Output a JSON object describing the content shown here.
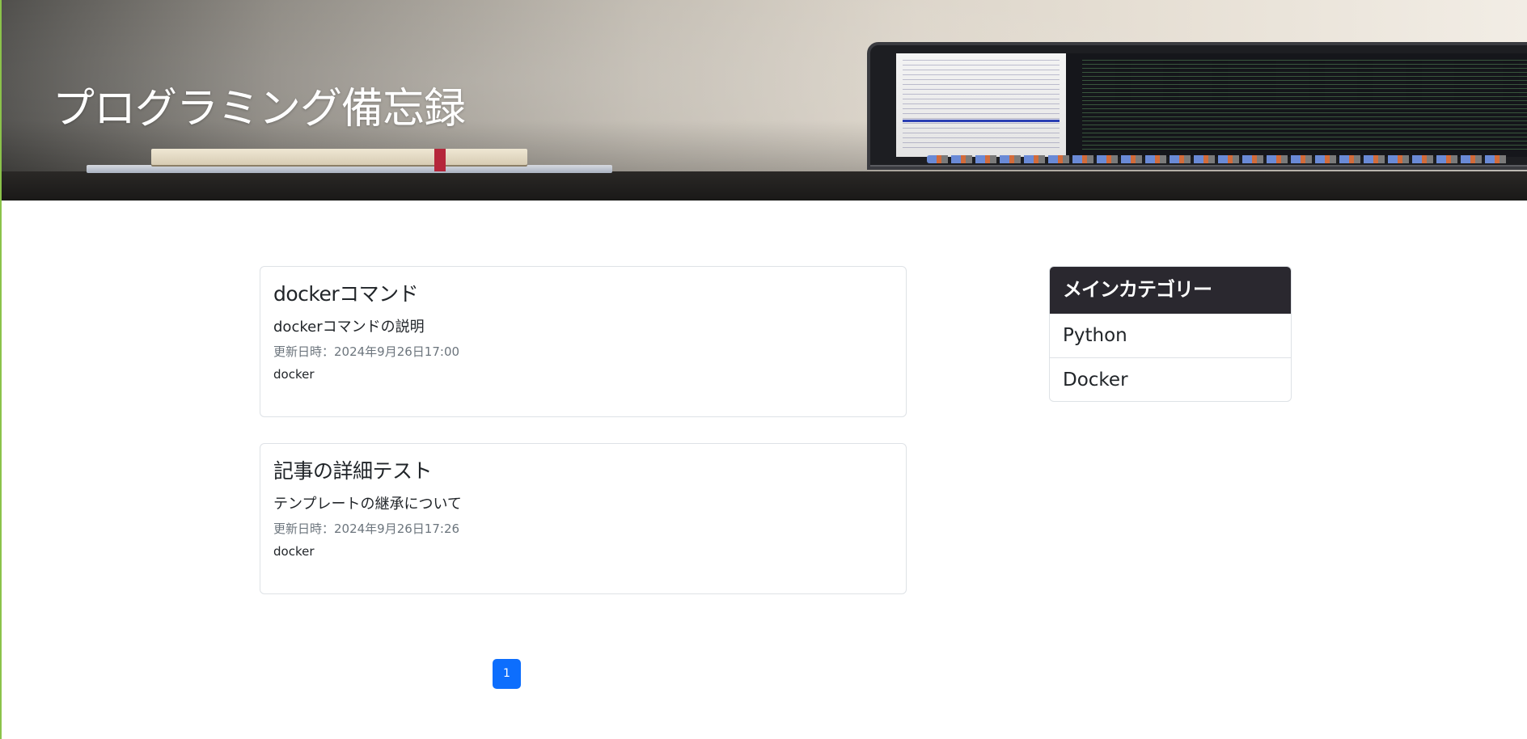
{
  "hero": {
    "title": "プログラミング備忘録"
  },
  "posts": [
    {
      "title": "dockerコマンド",
      "description": "dockerコマンドの説明",
      "updated": "更新日時：2024年9月26日17:00",
      "tag": "docker"
    },
    {
      "title": "記事の詳細テスト",
      "description": "テンプレートの継承について",
      "updated": "更新日時：2024年9月26日17:26",
      "tag": "docker"
    }
  ],
  "pagination": {
    "current": "1"
  },
  "sidebar": {
    "title": "メインカテゴリー",
    "items": [
      {
        "label": "Python"
      },
      {
        "label": "Docker"
      }
    ]
  },
  "colors": {
    "accent": "#0d6efd",
    "sidebar_header_bg": "#2a282f",
    "border": "#dee2e6",
    "muted_text": "#6c757d"
  }
}
